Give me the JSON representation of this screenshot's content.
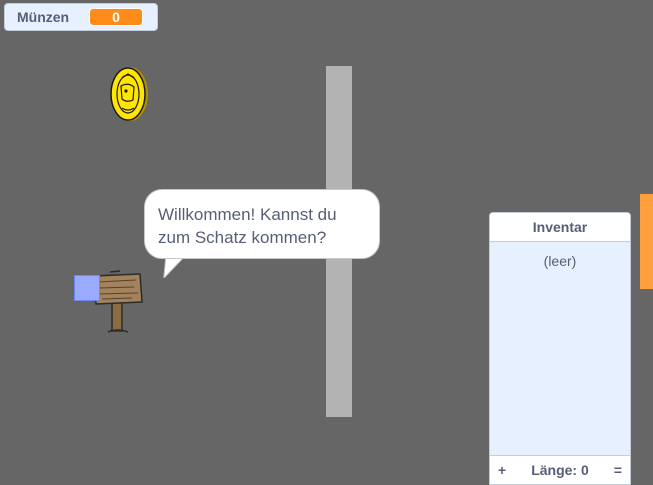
{
  "coin_counter": {
    "label": "Münzen",
    "value": "0"
  },
  "speech_bubble": {
    "line1": "Willkommen! Kannst du",
    "line2": "zum Schatz kommen?"
  },
  "inventory": {
    "title": "Inventar",
    "empty_text": "(leer)",
    "add_button": "+",
    "length_text": "Länge: 0",
    "resize_handle": "="
  },
  "colors": {
    "stage_background": "#666666",
    "wall": "#b3b3b3",
    "variable_value": "#ff8c1a",
    "player": "#99aaff",
    "coin": "#ffe600",
    "edge_tab": "#ff9f3e"
  },
  "icons": {
    "coin": "coin-icon",
    "sign": "signpost-icon",
    "player": "player-square"
  }
}
